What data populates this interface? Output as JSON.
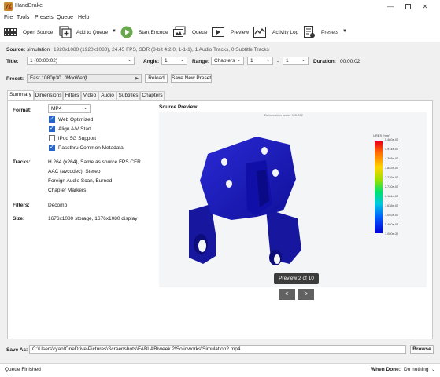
{
  "window": {
    "title": "HandBrake"
  },
  "menu": [
    "File",
    "Tools",
    "Presets",
    "Queue",
    "Help"
  ],
  "toolbar": {
    "open_source": "Open Source",
    "add_to_queue": "Add to Queue",
    "start_encode": "Start Encode",
    "queue": "Queue",
    "preview": "Preview",
    "activity_log": "Activity Log",
    "presets": "Presets"
  },
  "source": {
    "label": "Source:",
    "name": "simulation",
    "info": "1920x1080 (1920x1080), 24.45 FPS, SDR (8-bit 4:2:0, 1-1-1), 1 Audio Tracks, 0 Subtitle Tracks"
  },
  "title_row": {
    "title_label": "Title:",
    "title_value": "1 (00:00:02)",
    "angle_label": "Angle:",
    "angle_value": "1",
    "range_label": "Range:",
    "range_type": "Chapters",
    "range_start": "1",
    "range_dash": "-",
    "range_end": "1",
    "duration_label": "Duration:",
    "duration_value": "00:00:02"
  },
  "preset": {
    "label": "Preset:",
    "value": "Fast 1080p30",
    "modified": "(Modified)",
    "reload": "Reload",
    "save_new": "Save New Preset"
  },
  "tabs": [
    "Summary",
    "Dimensions",
    "Filters",
    "Video",
    "Audio",
    "Subtitles",
    "Chapters"
  ],
  "summary": {
    "format_label": "Format:",
    "format_value": "MP4",
    "options": [
      {
        "label": "Web Optimized",
        "checked": true
      },
      {
        "label": "Align A/V Start",
        "checked": true
      },
      {
        "label": "iPod 5G Support",
        "checked": false
      },
      {
        "label": "Passthru Common Metadata",
        "checked": true
      }
    ],
    "tracks_label": "Tracks:",
    "tracks": [
      "H.264 (x264), Same as source FPS CFR",
      "AAC (avcodec), Stereo",
      "Foreign Audio Scan, Burned",
      "Chapter Markers"
    ],
    "filters_label": "Filters:",
    "filters_value": "Decomb",
    "size_label": "Size:",
    "size_value": "1676x1080 storage, 1676x1080 display"
  },
  "preview": {
    "heading": "Source Preview:",
    "deformation_text": "Deformation scale: 926.872",
    "legend_title": "URES (mm)",
    "legend_ticks": [
      "5.460e-02",
      "4.914e-02",
      "4.368e-02",
      "3.822e-02",
      "3.276e-02",
      "2.730e-02",
      "2.184e-02",
      "1.638e-02",
      "1.092e-02",
      "5.460e-03",
      "1.000e-30"
    ],
    "badge": "Preview 2 of 10",
    "prev_btn": "<",
    "next_btn": ">"
  },
  "save_as": {
    "label": "Save As:",
    "path": "C:\\Users\\ryan\\OneDrive\\Pictures\\Screenshots\\FABLAB\\week 2\\Solidworks\\Simulation2.mp4",
    "browse": "Browse"
  },
  "status": {
    "text": "Queue Finished",
    "when_done_label": "When Done:",
    "when_done_value": "Do nothing"
  },
  "colors": {
    "accent": "#2565c7",
    "start_green": "#6aa84f",
    "part_blue": "#1c1cb8"
  }
}
